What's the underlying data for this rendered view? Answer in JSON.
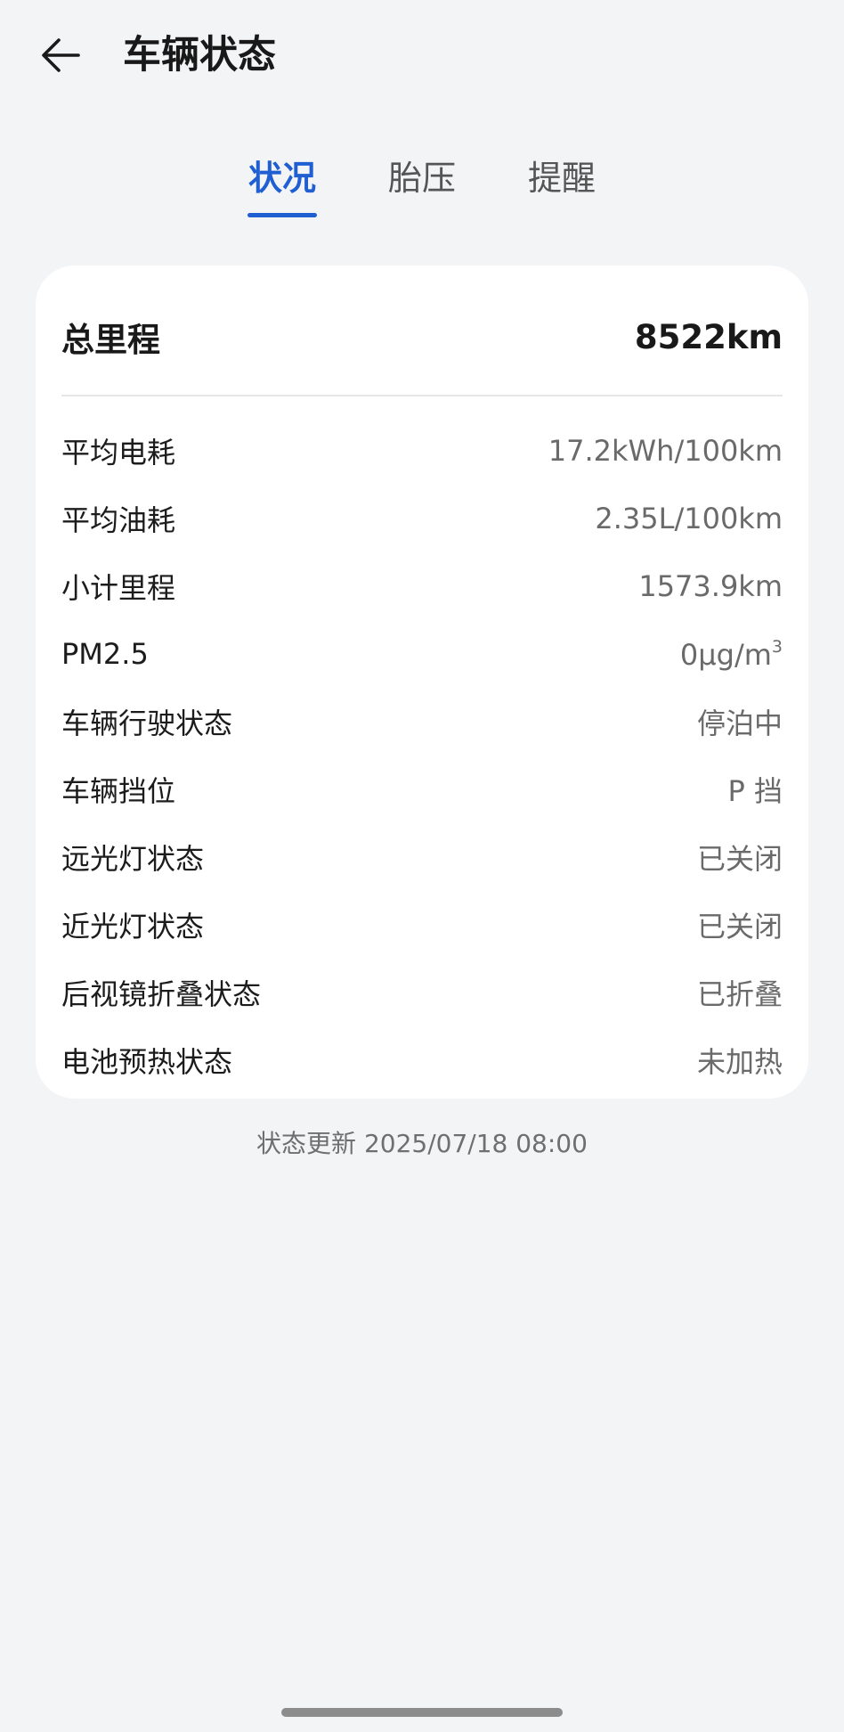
{
  "header": {
    "title": "车辆状态"
  },
  "tabs": [
    {
      "label": "状况",
      "active": true
    },
    {
      "label": "胎压",
      "active": false
    },
    {
      "label": "提醒",
      "active": false
    }
  ],
  "summary": {
    "total_label": "总里程",
    "total_value": "8522km"
  },
  "stats": [
    {
      "label": "平均电耗",
      "value": "17.2kWh/100km"
    },
    {
      "label": "平均油耗",
      "value": "2.35L/100km"
    },
    {
      "label": "小计里程",
      "value": "1573.9km"
    },
    {
      "label": "PM2.5",
      "value": "0μg/m",
      "value_sup": "3"
    },
    {
      "label": "车辆行驶状态",
      "value": "停泊中"
    },
    {
      "label": "车辆挡位",
      "value": "P 挡"
    },
    {
      "label": "远光灯状态",
      "value": "已关闭"
    },
    {
      "label": "近光灯状态",
      "value": "已关闭"
    },
    {
      "label": "后视镜折叠状态",
      "value": "已折叠"
    },
    {
      "label": "电池预热状态",
      "value": "未加热"
    }
  ],
  "footer": {
    "update_text": "状态更新 2025/07/18 08:00"
  },
  "colors": {
    "accent": "#1f5fd1",
    "background": "#f3f4f6",
    "card": "#ffffff"
  },
  "icons": {
    "back": "arrow-left-icon"
  }
}
